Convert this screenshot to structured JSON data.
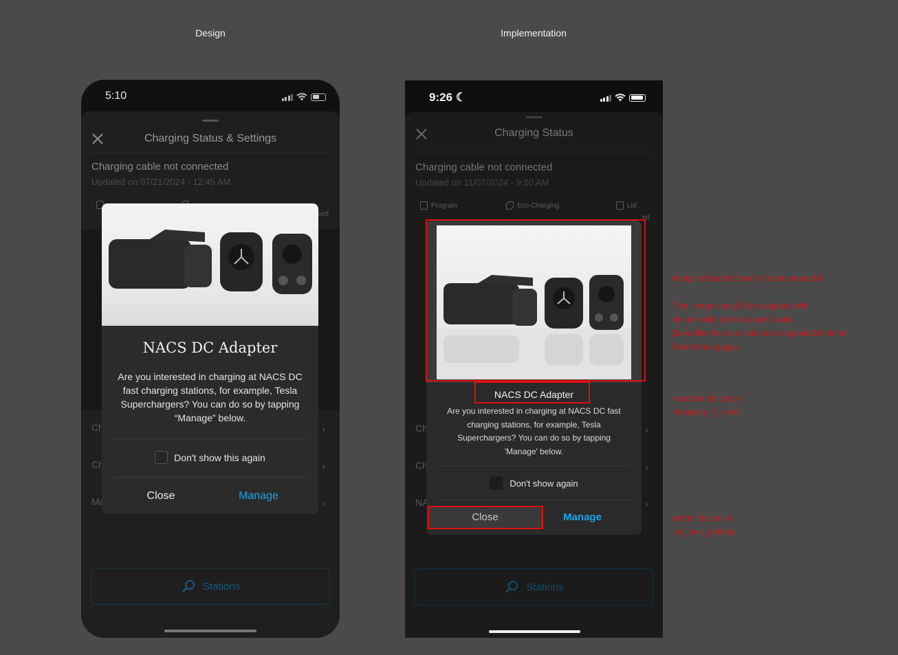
{
  "columns": {
    "design": "Design",
    "implementation": "Implementation"
  },
  "design": {
    "time": "5:10",
    "sheet_title": "Charging Status & Settings",
    "cable_status": "Charging cable not connected",
    "updated": "Updated on 07/21/2024 - 12:45 AM",
    "quick_partial": "sed",
    "rows": [
      "Ch",
      "Ch",
      "Ma"
    ],
    "dialog": {
      "headline": "NACS DC Adapter",
      "body": "Are you interested in charging at NACS DC fast charging stations, for example, Tesla Superchargers? You can do so by tapping “Manage” below.",
      "checkbox_label": "Don't show this again",
      "close_label": "Close",
      "manage_label": "Manage"
    },
    "stations_label": "Stations"
  },
  "implementation": {
    "time": "9:26",
    "sheet_title": "Charging Status",
    "cable_status": "Charging cable not connected",
    "updated": "Updated on 11/07/2024 - 9:20 AM",
    "quick_items": [
      "Program",
      "Eco-Charging",
      "Lid"
    ],
    "quick_partial": "ed",
    "rows": [
      "Ch",
      "Ch",
      "NA"
    ],
    "dialog": {
      "headline": "NACS DC Adapter",
      "body": "Are you interested in charging at NACS DC fast charging stations, for example, Tesla Superchargers? You can do so by tapping 'Manage' below.",
      "checkbox_label": "Don't show again",
      "close_label": "Close",
      "manage_label": "Manage"
    },
    "stations_label": "Stations"
  },
  "annotations": {
    "image_notes": [
      "-Image shouldn't have a frame around it.",
      "",
      "-The image should be swapped with",
      "the one with correct aspect ratio.",
      "(looks like the one used are supposed to be for",
      "Read More page)"
    ],
    "headline_notes": [
      "Headline font style",
      ": headline_5_serif"
    ],
    "button_notes": [
      "button font color",
      ": ris_text_primary"
    ]
  },
  "colors": {
    "accent_blue": "#1ea2e6",
    "annotation_red": "#e01010",
    "background": "#4a4a4a"
  },
  "icons": [
    "close-icon",
    "signal-icon",
    "wifi-icon",
    "battery-icon",
    "moon-icon",
    "chevron-right-icon",
    "search-icon"
  ]
}
